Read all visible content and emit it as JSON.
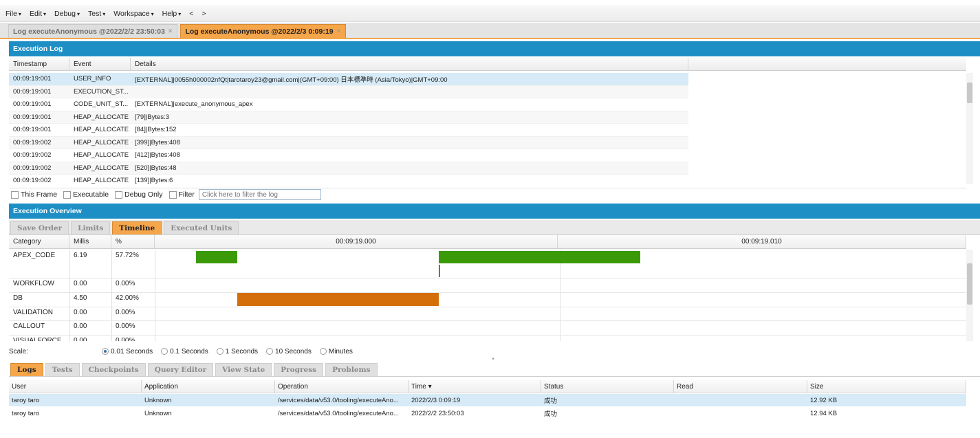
{
  "menu": [
    {
      "label": "File",
      "caret": "▾"
    },
    {
      "label": "Edit",
      "caret": "▾"
    },
    {
      "label": "Debug",
      "caret": "▾"
    },
    {
      "label": "Test",
      "caret": "▾"
    },
    {
      "label": "Workspace",
      "caret": "▾"
    },
    {
      "label": "Help",
      "caret": "▾"
    },
    {
      "label": "<",
      "caret": ""
    },
    {
      "label": ">",
      "caret": ""
    }
  ],
  "doc_tabs": [
    {
      "label": "Log executeAnonymous @2022/2/2 23:50:03",
      "active": false
    },
    {
      "label": "Log executeAnonymous @2022/2/3 0:09:19",
      "active": true
    }
  ],
  "execution_log": {
    "title": "Execution Log",
    "columns": [
      "Timestamp",
      "Event",
      "Details"
    ],
    "rows": [
      [
        "00:09:19:001",
        "USER_INFO",
        "[EXTERNAL]|0055h000002nfQt|tarotaroy23@gmail.com|(GMT+09:00) 日本標準時 (Asia/Tokyo)|GMT+09:00"
      ],
      [
        "00:09:19:001",
        "EXECUTION_ST...",
        ""
      ],
      [
        "00:09:19:001",
        "CODE_UNIT_ST...",
        "[EXTERNAL]|execute_anonymous_apex"
      ],
      [
        "00:09:19:001",
        "HEAP_ALLOCATE",
        "[79]|Bytes:3"
      ],
      [
        "00:09:19:001",
        "HEAP_ALLOCATE",
        "[84]|Bytes:152"
      ],
      [
        "00:09:19:002",
        "HEAP_ALLOCATE",
        "[399]|Bytes:408"
      ],
      [
        "00:09:19:002",
        "HEAP_ALLOCATE",
        "[412]|Bytes:408"
      ],
      [
        "00:09:19:002",
        "HEAP_ALLOCATE",
        "[520]|Bytes:48"
      ],
      [
        "00:09:19:002",
        "HEAP_ALLOCATE",
        "[139]|Bytes:6"
      ]
    ],
    "filters": {
      "this_frame": "This Frame",
      "executable": "Executable",
      "debug_only": "Debug Only",
      "filter": "Filter",
      "filter_placeholder": "Click here to filter the log"
    }
  },
  "execution_overview": {
    "title": "Execution Overview",
    "tabs": [
      {
        "label": "Save Order",
        "active": false
      },
      {
        "label": "Limits",
        "active": false
      },
      {
        "label": "Timeline",
        "active": true
      },
      {
        "label": "Executed Units",
        "active": false
      }
    ],
    "columns": [
      "Category",
      "Millis",
      "%"
    ],
    "time_labels": [
      "00:09:19.000",
      "00:09:19.010"
    ],
    "rows": [
      {
        "category": "APEX_CODE",
        "millis": "6.19",
        "pct": "57.72%"
      },
      {
        "category": "WORKFLOW",
        "millis": "0.00",
        "pct": "0.00%"
      },
      {
        "category": "DB",
        "millis": "4.50",
        "pct": "42.00%"
      },
      {
        "category": "VALIDATION",
        "millis": "0.00",
        "pct": "0.00%"
      },
      {
        "category": "CALLOUT",
        "millis": "0.00",
        "pct": "0.00%"
      },
      {
        "category": "VISUALFORCE",
        "millis": "0.00",
        "pct": "0.00%"
      }
    ],
    "colors": {
      "apex": "#3a9a07",
      "db": "#d46e0b"
    },
    "scale_label": "Scale:",
    "scale_options": [
      {
        "label": "0.01 Seconds",
        "selected": true
      },
      {
        "label": "0.1 Seconds",
        "selected": false
      },
      {
        "label": "1 Seconds",
        "selected": false
      },
      {
        "label": "10 Seconds",
        "selected": false
      },
      {
        "label": "Minutes",
        "selected": false
      }
    ]
  },
  "bottom_panel": {
    "tabs": [
      {
        "label": "Logs",
        "active": true
      },
      {
        "label": "Tests",
        "active": false
      },
      {
        "label": "Checkpoints",
        "active": false
      },
      {
        "label": "Query Editor",
        "active": false
      },
      {
        "label": "View State",
        "active": false
      },
      {
        "label": "Progress",
        "active": false
      },
      {
        "label": "Problems",
        "active": false
      }
    ],
    "columns": [
      "User",
      "Application",
      "Operation",
      "Time ▾",
      "Status",
      "Read",
      "Size"
    ],
    "rows": [
      [
        "taroy taro",
        "Unknown",
        "/services/data/v53.0/tooling/executeAno...",
        "2022/2/3 0:09:19",
        "成功",
        "",
        "12.92 KB"
      ],
      [
        "taroy taro",
        "Unknown",
        "/services/data/v53.0/tooling/executeAno...",
        "2022/2/2 23:50:03",
        "成功",
        "",
        "12.94 KB"
      ]
    ]
  }
}
